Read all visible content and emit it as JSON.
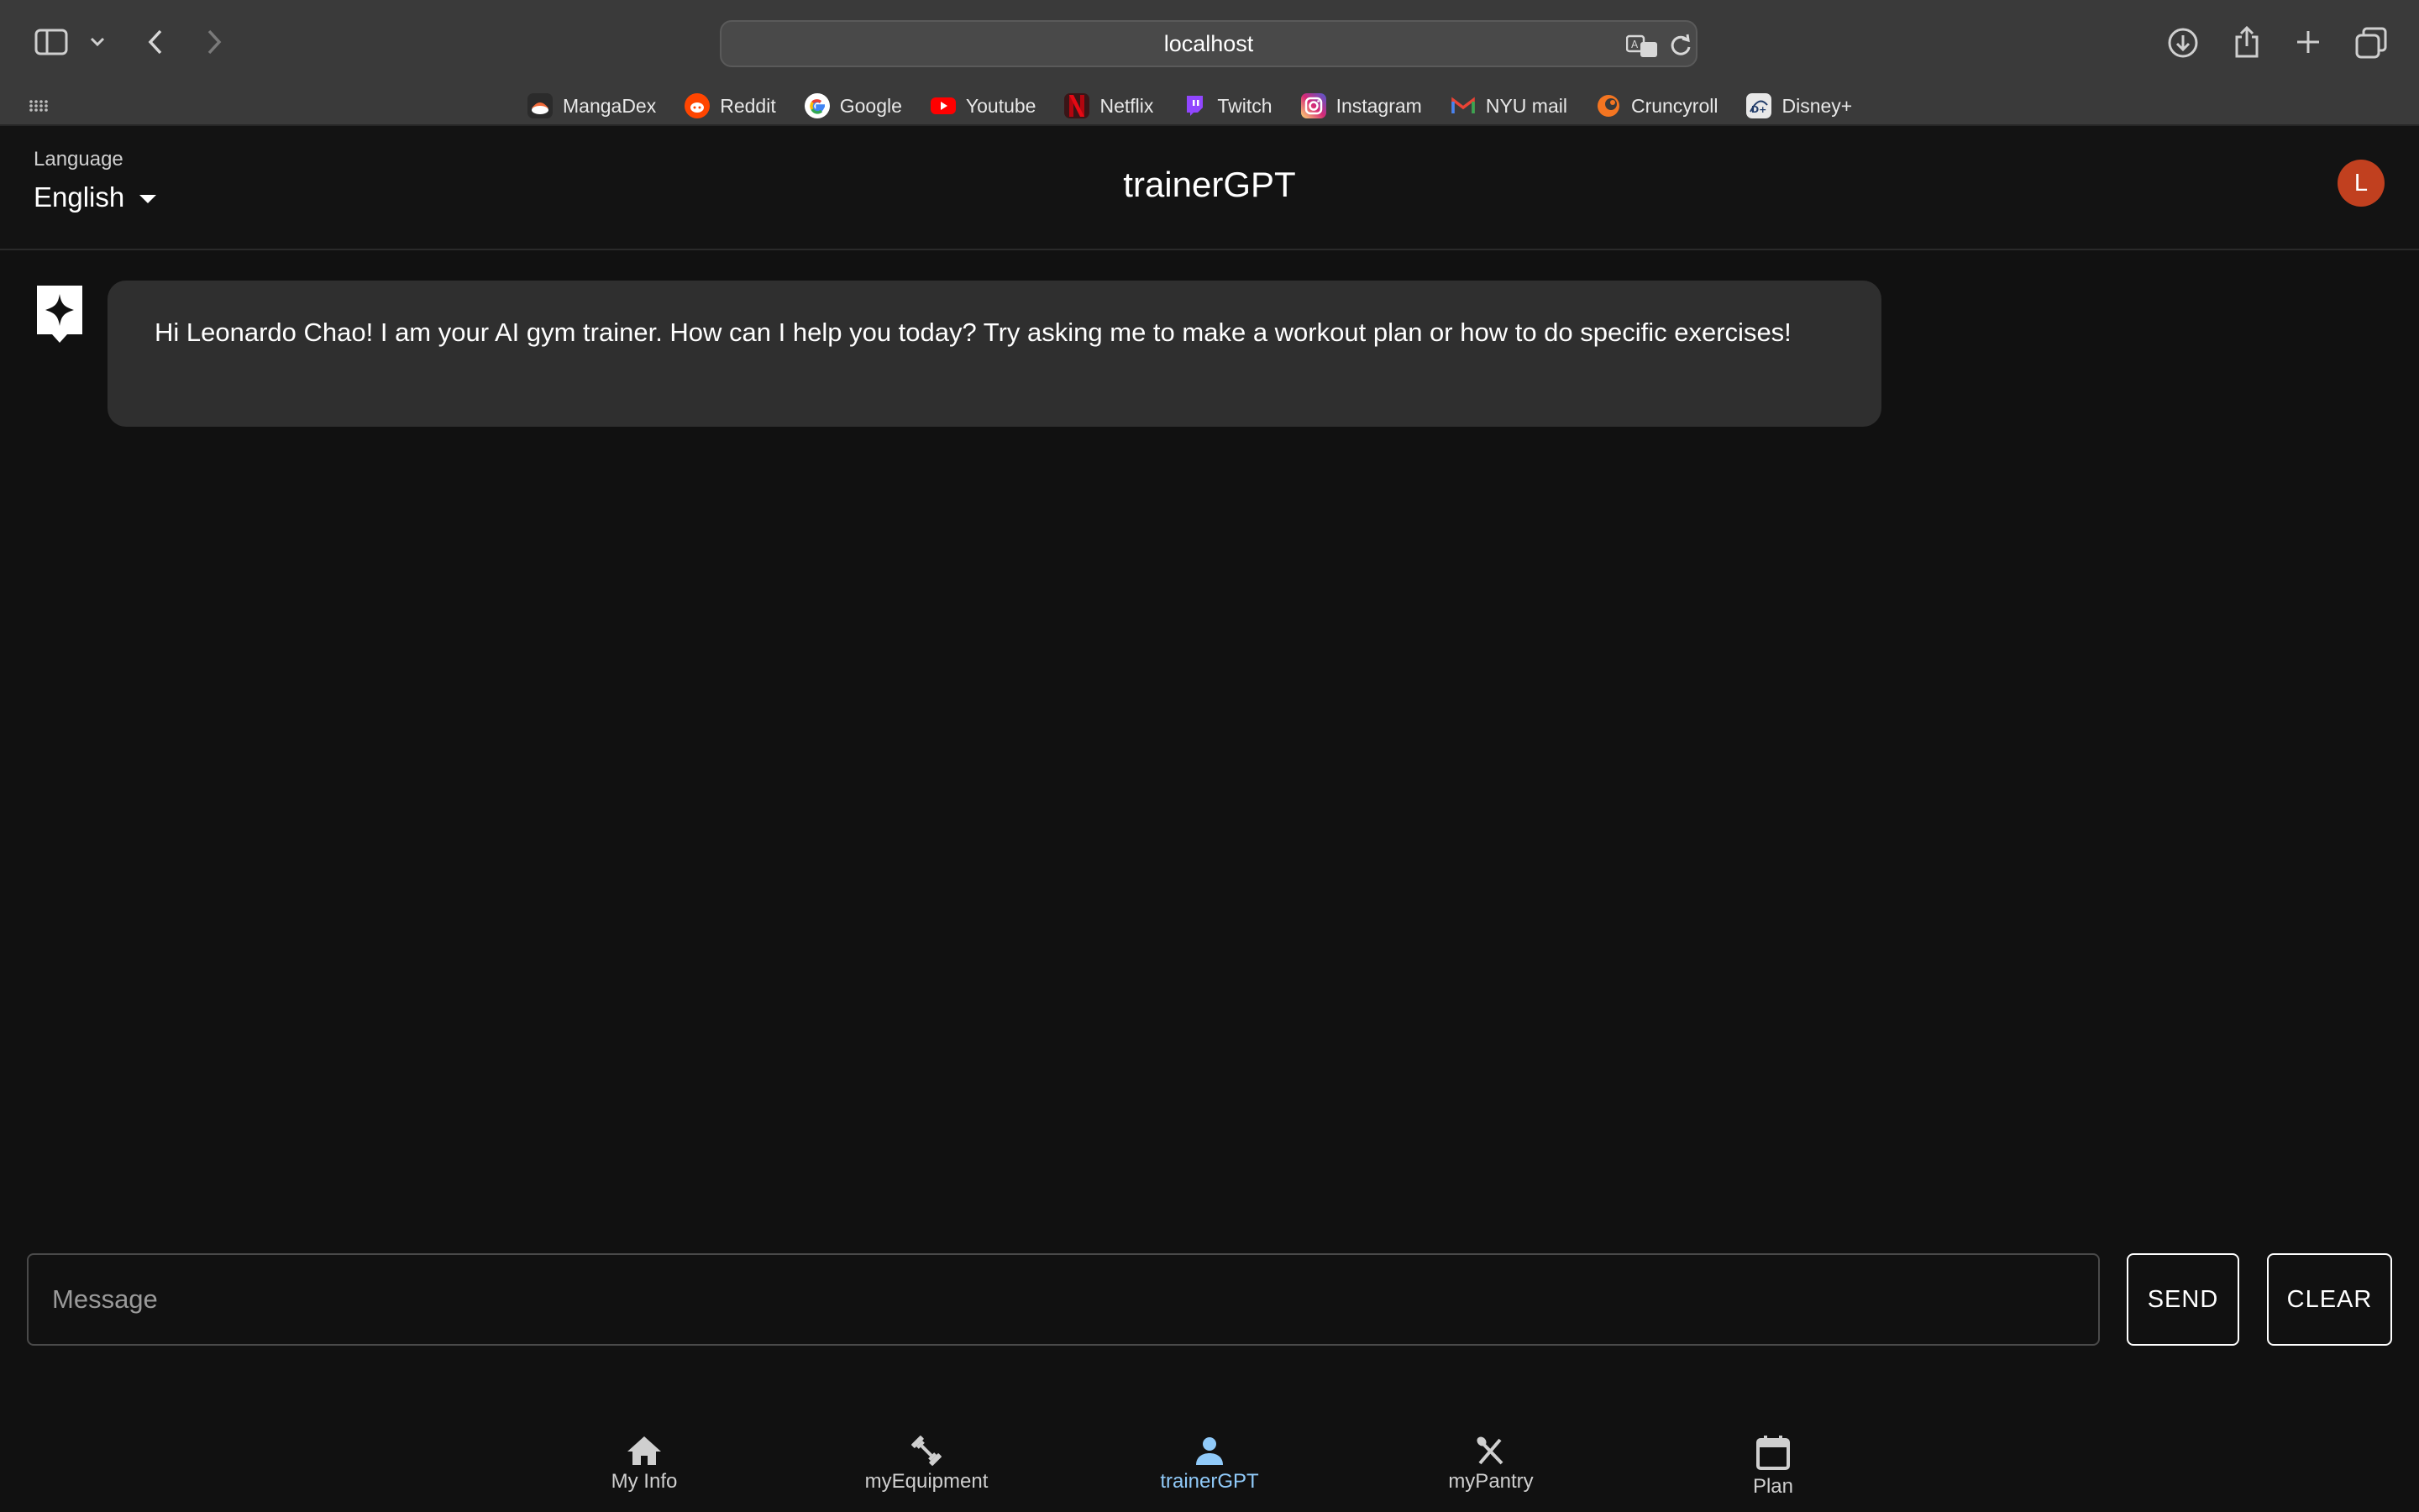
{
  "browser": {
    "url": "localhost",
    "bookmarks": [
      {
        "label": "MangaDex",
        "icon": "mangadex-favicon",
        "color": "#2b2b2b"
      },
      {
        "label": "Reddit",
        "icon": "reddit-favicon",
        "color": "#ff4500"
      },
      {
        "label": "Google",
        "icon": "google-favicon",
        "color": "#ffffff"
      },
      {
        "label": "Youtube",
        "icon": "youtube-favicon",
        "color": "#ff0000"
      },
      {
        "label": "Netflix",
        "icon": "netflix-favicon",
        "color": "#b1060f"
      },
      {
        "label": "Twitch",
        "icon": "twitch-favicon",
        "color": "#9146ff"
      },
      {
        "label": "Instagram",
        "icon": "instagram-favicon",
        "color": "#d62976"
      },
      {
        "label": "NYU mail",
        "icon": "gmail-favicon",
        "color": "#ea4335"
      },
      {
        "label": "Cruncyroll",
        "icon": "crunchyroll-favicon",
        "color": "#f47521"
      },
      {
        "label": "Disney+",
        "icon": "disney-favicon",
        "color": "#e8e8e8"
      }
    ]
  },
  "header": {
    "language_label": "Language",
    "language_value": "English",
    "title": "trainerGPT",
    "avatar_initial": "L",
    "avatar_color": "#c1401f"
  },
  "chat": {
    "messages": [
      {
        "role": "assistant",
        "text": "Hi Leonardo Chao! I am your AI gym trainer. How can I help you today? Try asking me to make a workout plan or how to do specific exercises!"
      }
    ]
  },
  "composer": {
    "placeholder": "Message",
    "send_label": "SEND",
    "clear_label": "CLEAR"
  },
  "nav": {
    "active_color": "#90caf9",
    "items": [
      {
        "label": "My Info",
        "icon": "home-icon"
      },
      {
        "label": "myEquipment",
        "icon": "dumbbell-icon"
      },
      {
        "label": "trainerGPT",
        "icon": "person-icon",
        "active": true
      },
      {
        "label": "myPantry",
        "icon": "utensils-icon"
      },
      {
        "label": "Plan",
        "icon": "calendar-icon"
      }
    ]
  }
}
